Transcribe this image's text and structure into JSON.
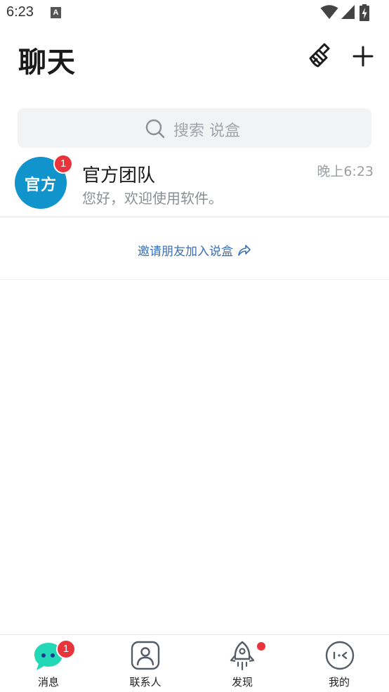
{
  "status_bar": {
    "time": "6:23",
    "notification_badge": "A",
    "icons": [
      "wifi-icon",
      "signal-icon",
      "battery-charging-icon"
    ]
  },
  "header": {
    "title": "聊天",
    "actions": [
      "brush-clean-icon",
      "plus-icon"
    ]
  },
  "search": {
    "placeholder": "搜索 说盒",
    "icon": "search-icon"
  },
  "chats": [
    {
      "avatar_text": "官方",
      "avatar_color": "#1193cc",
      "unread": "1",
      "name": "官方团队",
      "preview": "您好，欢迎使用软件。",
      "time": "晚上6:23"
    }
  ],
  "invite": {
    "label": "邀请朋友加入说盒",
    "icon": "share-arrow-icon"
  },
  "bottom_nav": [
    {
      "label": "消息",
      "icon": "message-bubble-icon",
      "badge": "1",
      "active": true
    },
    {
      "label": "联系人",
      "icon": "contacts-icon"
    },
    {
      "label": "发现",
      "icon": "rocket-icon",
      "dot": true
    },
    {
      "label": "我的",
      "icon": "profile-face-icon"
    }
  ],
  "colors": {
    "accent": "#1193cc",
    "badge": "#e8343a",
    "link": "#3a6fb8",
    "active_icon": "#22d8b6"
  }
}
